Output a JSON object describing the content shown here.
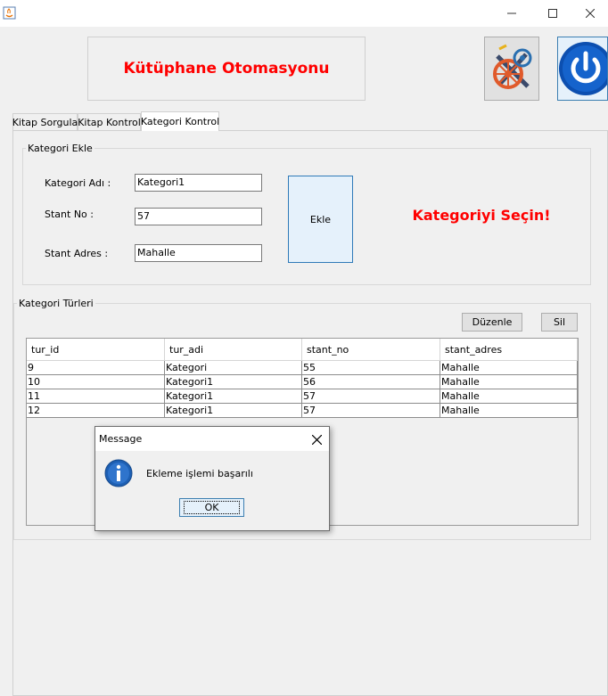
{
  "header": {
    "title": "Kütüphane Otomasyonu"
  },
  "tabs": [
    "Kitap Sorgula",
    "Kitap Kontrol",
    "Kategori Kontrol"
  ],
  "kategori_ekle": {
    "legend": "Kategori Ekle",
    "fields": [
      {
        "label": "Kategori Adı :",
        "value": "Kategori1"
      },
      {
        "label": "Stant No :",
        "value": "57"
      },
      {
        "label": "Stant Adres :",
        "value": "Mahalle"
      }
    ],
    "add_button": "Ekle",
    "select_message": "Kategoriyi Seçin!"
  },
  "kategori_turleri": {
    "legend": "Kategori Türleri",
    "edit_button": "Düzenle",
    "delete_button": "Sil",
    "columns": [
      "tur_id",
      "tur_adi",
      "stant_no",
      "stant_adres"
    ],
    "rows": [
      [
        "9",
        "Kategori",
        "55",
        "Mahalle"
      ],
      [
        "10",
        "Kategori1",
        "56",
        "Mahalle"
      ],
      [
        "11",
        "Kategori1",
        "57",
        "Mahalle"
      ],
      [
        "12",
        "Kategori1",
        "57",
        "Mahalle"
      ]
    ]
  },
  "dialog": {
    "title": "Message",
    "message": "Ekleme işlemi başarılı",
    "ok_button": "OK",
    "icon": "info-icon"
  },
  "colors": {
    "accent_red": "#ff0000",
    "dialog_icon_blue": "#1d5fb3"
  }
}
